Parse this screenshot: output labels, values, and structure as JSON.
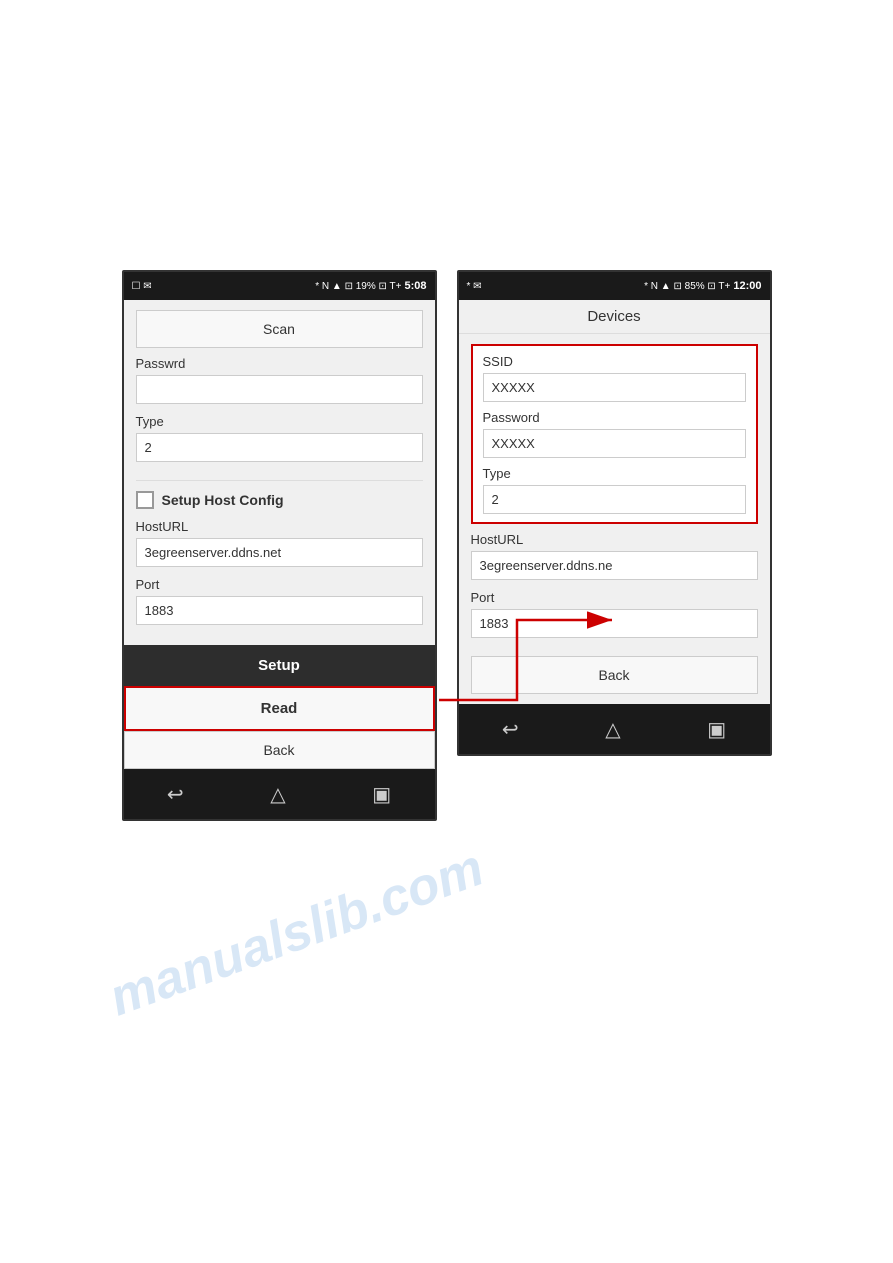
{
  "watermark": "manualslib.com",
  "left_phone": {
    "status_bar": {
      "icons_left": "☐ ✉",
      "icons_right": "* N ▲ ⊡ 19% ⊡ T+",
      "time": "5:08"
    },
    "scan_button": "Scan",
    "password_label": "Passwrd",
    "password_value": "",
    "type_label": "Type",
    "type_value": "2",
    "setup_host_label": "Setup Host Config",
    "host_url_label": "HostURL",
    "host_url_value": "3egreenserver.ddns.net",
    "port_label": "Port",
    "port_value": "1883",
    "setup_button": "Setup",
    "read_button": "Read",
    "back_button": "Back",
    "nav_back": "↩",
    "nav_home": "△",
    "nav_recent": "▣"
  },
  "right_phone": {
    "status_bar": {
      "icons_left": "* ✉",
      "icons_right": "* N ▲ ⊡ 85% ⊡ T+",
      "time": "12:00"
    },
    "title": "Devices",
    "ssid_label": "SSID",
    "ssid_value": "XXXXX",
    "password_label": "Password",
    "password_value": "XXXXX",
    "type_label": "Type",
    "type_value": "2",
    "host_url_label": "HostURL",
    "host_url_value": "3egreenserver.ddns.ne",
    "port_label": "Port",
    "port_value": "1883",
    "back_button": "Back",
    "nav_back": "↩",
    "nav_home": "△",
    "nav_recent": "▣"
  }
}
